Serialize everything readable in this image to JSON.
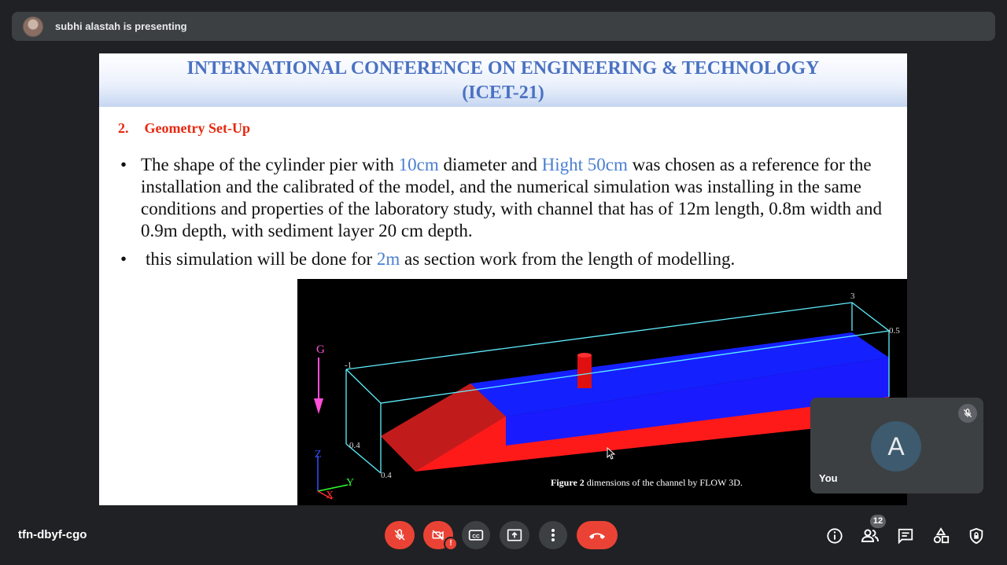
{
  "presenter": {
    "text": "subhi alastah is presenting"
  },
  "slide": {
    "header_line1": "INTERNATIONAL CONFERENCE ON ENGINEERING & TECHNOLOGY",
    "header_line2": "(ICET-21)",
    "section_number": "2.",
    "section_title": "Geometry Set-Up",
    "bullet_marker": "•",
    "bullet1": {
      "a": "The shape of the cylinder pier with ",
      "b": "10cm",
      "c": " diameter and ",
      "d": "Hight 50cm",
      "e": " was chosen as a reference for the installation and the calibrated of the model, and the numerical simulation was installing in the same conditions and properties of the laboratory study, with channel that has of 12m length, 0.8m width and 0.9m depth, with sediment layer 20 cm depth."
    },
    "bullet2": {
      "a": "this simulation will be done for ",
      "b": "2m",
      "c": " as section work from the length of modelling."
    },
    "figure": {
      "caption_bold": "Figure 2",
      "caption_rest": " dimensions of the channel by FLOW 3D.",
      "axis_g": "G",
      "axis_z": "Z",
      "axis_y": "Y",
      "axis_x": "X",
      "tick_3": "3",
      "tick_05": "0.5",
      "tick_m1": "-1",
      "tick_04a": "0.4",
      "tick_04b": "0.4"
    }
  },
  "self_tile": {
    "initial": "A",
    "name": "You"
  },
  "meeting": {
    "code": "tfn-dbyf-cgo"
  },
  "participants": {
    "count": "12"
  },
  "colors": {
    "background": "#202124",
    "control": "#3c4043",
    "danger": "#ea4335",
    "slide_title": "#4a72c2",
    "section_red": "#e8280f",
    "highlight_blue": "#4a7fd0"
  }
}
